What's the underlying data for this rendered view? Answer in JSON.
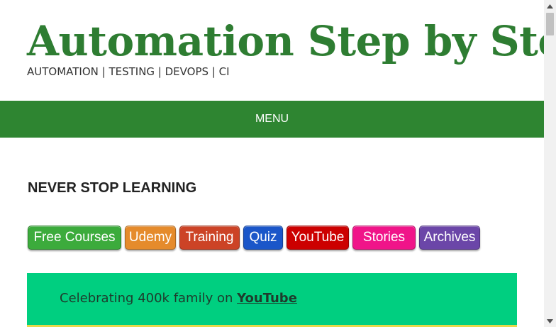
{
  "header": {
    "site_title": "Automation Step by Step",
    "tagline": "AUTOMATION | TESTING | DEVOPS | CI"
  },
  "nav": {
    "menu_label": "MENU"
  },
  "main": {
    "heading": "NEVER STOP LEARNING",
    "buttons": [
      {
        "label": "Free Courses",
        "color": "#3cab3c"
      },
      {
        "label": "Udemy",
        "color": "#e58b2c"
      },
      {
        "label": "Training",
        "color": "#cc4326"
      },
      {
        "label": "Quiz",
        "color": "#1a56c9"
      },
      {
        "label": "YouTube",
        "color": "#cc0000"
      },
      {
        "label": "Stories",
        "color": "#f01489"
      },
      {
        "label": "Archives",
        "color": "#6b46a8"
      }
    ],
    "banner": {
      "text": "Celebrating 400k family on ",
      "link": "YouTube"
    }
  },
  "colors": {
    "brand_green": "#2e7d32",
    "nav_green": "#2e8531",
    "banner_green": "#00cf80"
  }
}
